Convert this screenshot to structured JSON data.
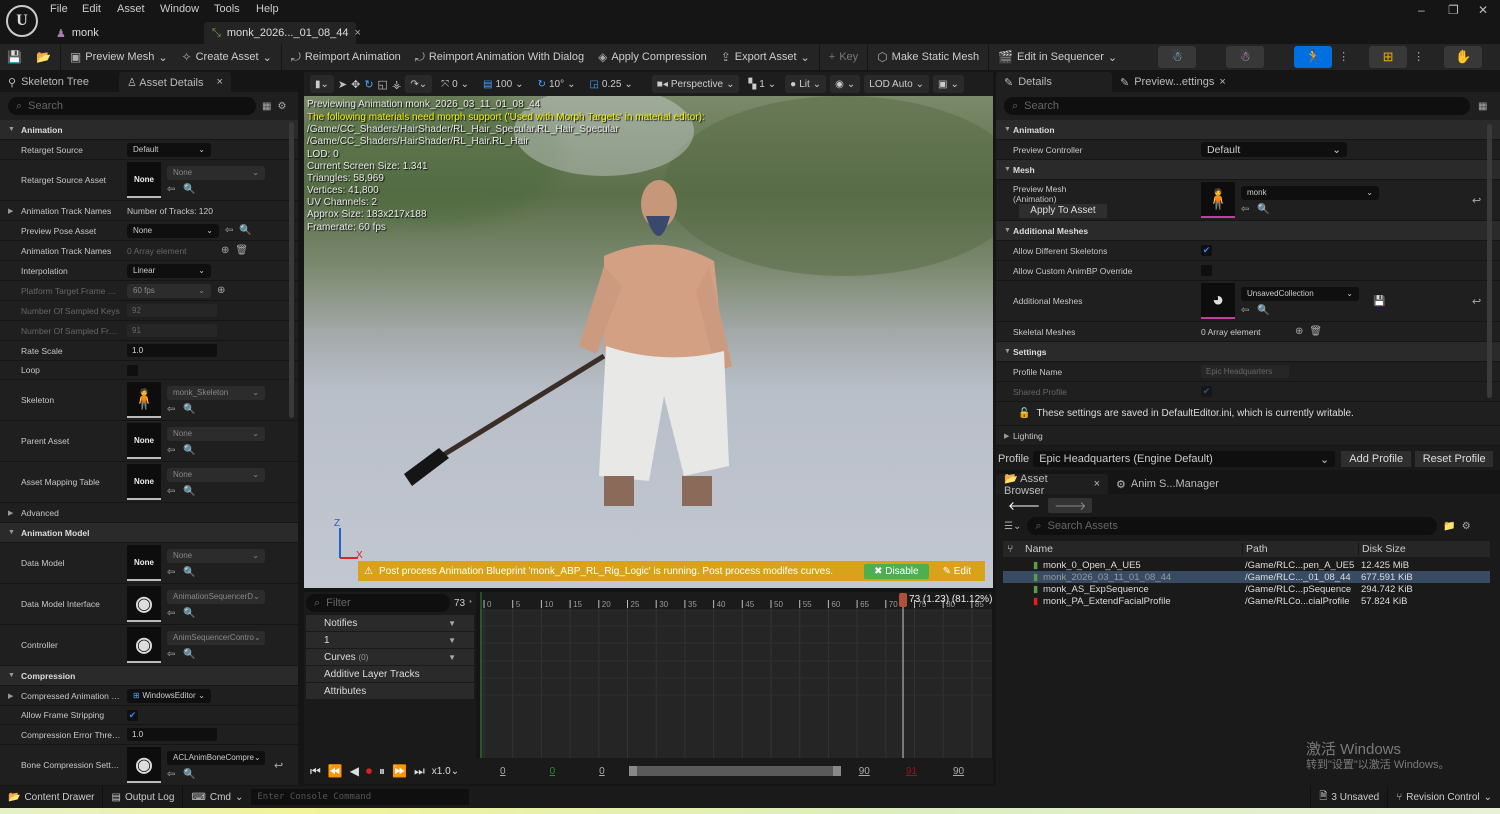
{
  "menu": [
    "File",
    "Edit",
    "Asset",
    "Window",
    "Tools",
    "Help"
  ],
  "doc_tabs": [
    {
      "label": "monk"
    },
    {
      "label": "monk_2026..._01_08_44"
    }
  ],
  "window_controls": [
    "–",
    "❐",
    "✕"
  ],
  "toolbar": {
    "save_icon": "save-icon",
    "browse_icon": "browse-icon",
    "items": [
      "Preview Mesh",
      "Create Asset",
      "Reimport Animation",
      "Reimport Animation With Dialog",
      "Apply Compression",
      "Export Asset",
      "Key",
      "Make Static Mesh",
      "Edit in Sequencer"
    ],
    "mode_colors": {
      "active": "#0070e0"
    }
  },
  "left_panel": {
    "tabs": [
      "Skeleton Tree",
      "Asset Details"
    ],
    "search_placeholder": "Search",
    "rows": [
      {
        "type": "section",
        "label": "Animation"
      },
      {
        "type": "dropdown",
        "label": "Retarget Source",
        "value": "Default"
      },
      {
        "type": "asset",
        "label": "Retarget Source Asset",
        "thumb": "None",
        "value": "None",
        "small": true
      },
      {
        "type": "text",
        "label": "Animation Track Names",
        "value": "Number of Tracks: 120",
        "expand": true
      },
      {
        "type": "dropdown",
        "label": "Preview Pose Asset",
        "value": "None",
        "icons": true
      },
      {
        "type": "array",
        "label": "Animation Track Names",
        "value": "0 Array element"
      },
      {
        "type": "dropdown",
        "label": "Interpolation",
        "value": "Linear"
      },
      {
        "type": "dropdown",
        "label": "Platform Target Frame Rate",
        "value": "60 fps",
        "disabled": true,
        "plus": true
      },
      {
        "type": "input",
        "label": "Number Of Sampled Keys",
        "value": "92",
        "disabled": true
      },
      {
        "type": "input",
        "label": "Number Of Sampled Frames",
        "value": "91",
        "disabled": true
      },
      {
        "type": "input",
        "label": "Rate Scale",
        "value": "1.0"
      },
      {
        "type": "check",
        "label": "Loop",
        "checked": false
      },
      {
        "type": "asset",
        "label": "Skeleton",
        "thumb": "",
        "value": "monk_Skeleton",
        "thumb_kind": "skeleton"
      },
      {
        "type": "asset",
        "label": "Parent Asset",
        "thumb": "None",
        "value": "None"
      },
      {
        "type": "asset",
        "label": "Asset Mapping Table",
        "thumb": "None",
        "value": "None"
      },
      {
        "type": "collapsed",
        "label": "Advanced"
      },
      {
        "type": "section",
        "label": "Animation Model"
      },
      {
        "type": "asset",
        "label": "Data Model",
        "thumb": "None",
        "value": "None"
      },
      {
        "type": "asset",
        "label": "Data Model Interface",
        "thumb": "",
        "value": "AnimationSequencerD",
        "thumb_kind": "sphere"
      },
      {
        "type": "asset",
        "label": "Controller",
        "thumb": "",
        "value": "AnimSequencerContro",
        "thumb_kind": "sphere"
      },
      {
        "type": "section",
        "label": "Compression"
      },
      {
        "type": "dropdown",
        "label": "Compressed Animation Data",
        "value": "WindowsEditor",
        "expand": true
      },
      {
        "type": "check",
        "label": "Allow Frame Stripping",
        "checked": true
      },
      {
        "type": "input",
        "label": "Compression Error Thresh...",
        "value": "1.0"
      },
      {
        "type": "asset",
        "label": "Bone Compression Settings",
        "thumb": "",
        "value": "ACLAnimBoneCompre",
        "thumb_kind": "sphere",
        "reset": true,
        "dark": true
      }
    ]
  },
  "viewport": {
    "toolbar": {
      "translate_snap": "0",
      "grid": "100",
      "rotate_snap": "10°",
      "scale_snap": "0.25",
      "view": "Perspective",
      "speed": "1",
      "lighting": "Lit",
      "lod": "LOD Auto"
    },
    "overlay": {
      "previewing": "Previewing Animation monk_2026_03_11_01_08_44",
      "warning": "The following materials need morph support ('Used with Morph Targets' in material editor):",
      "paths": [
        "/Game/CC_Shaders/HairShader/RL_Hair_Specular.RL_Hair_Specular",
        "/Game/CC_Shaders/HairShader/RL_Hair.RL_Hair"
      ],
      "stats": [
        "LOD: 0",
        "Current Screen Size: 1.341",
        "Triangles: 58,969",
        "Vertices: 41,800",
        "UV Channels: 2",
        "Approx Size: 183x217x188",
        "Framerate: 60 fps"
      ]
    },
    "axis": {
      "z": "Z",
      "x": "X"
    },
    "banner": {
      "text": "Post process Animation Blueprint 'monk_ABP_RL_Rig_Logic' is running. Post process modifes curves.",
      "disable": "Disable",
      "edit": "Edit"
    }
  },
  "timeline": {
    "filter_placeholder": "Filter",
    "current_frame": "73",
    "tracks": [
      {
        "label": "Notifies",
        "dd": true
      },
      {
        "label": "1",
        "dd": true
      },
      {
        "label": "Curves",
        "count": "(0)",
        "dd": true
      },
      {
        "label": "Additive Layer Tracks"
      },
      {
        "label": "Attributes"
      }
    ],
    "ticks": [
      0,
      5,
      10,
      15,
      20,
      25,
      30,
      35,
      40,
      45,
      50,
      55,
      60,
      65,
      70,
      75,
      80,
      85,
      90
    ],
    "max_frame": 91,
    "playhead_label": "73 (1.23) (81.12%)",
    "playhead_frame": 73,
    "speed": "x1.0",
    "range": {
      "start": "0",
      "start_green": "0",
      "view_start": "0",
      "view_end": "90",
      "end_red": "91",
      "end": "90"
    }
  },
  "right_panel": {
    "tabs": [
      "Details",
      "Preview...ettings"
    ],
    "search_placeholder": "Search",
    "rows": [
      {
        "type": "section",
        "label": "Animation"
      },
      {
        "type": "dropdown",
        "label": "Preview Controller",
        "value": "Default",
        "big": true
      },
      {
        "type": "section",
        "label": "Mesh"
      },
      {
        "type": "asset",
        "label": "Preview Mesh\n(Animation)",
        "thumb": "",
        "value": "monk",
        "thumb_kind": "person",
        "button": "Apply To Asset",
        "reset": true
      },
      {
        "type": "section",
        "label": "Additional Meshes"
      },
      {
        "type": "check",
        "label": "Allow Different Skeletons",
        "checked": true
      },
      {
        "type": "check",
        "label": "Allow Custom AnimBP Override",
        "checked": false
      },
      {
        "type": "asset",
        "label": "Additional Meshes",
        "thumb": "",
        "value": "UnsavedCollection",
        "thumb_kind": "pie",
        "reset": true,
        "save": true
      },
      {
        "type": "array",
        "label": "Skeletal Meshes",
        "value": "0 Array element"
      },
      {
        "type": "section",
        "label": "Settings"
      },
      {
        "type": "input",
        "label": "Profile Name",
        "value": "Epic Headquarters",
        "disabled": true
      },
      {
        "type": "check",
        "label": "Shared Profile",
        "checked": true,
        "dimlabel": true
      },
      {
        "type": "note",
        "label": "These settings are saved in DefaultEditor.ini, which is currently writable."
      },
      {
        "type": "collapsed",
        "label": "Lighting"
      }
    ],
    "profile": {
      "label": "Profile",
      "value": "Epic Headquarters (Engine Default)",
      "add": "Add Profile",
      "reset": "Reset Profile"
    }
  },
  "asset_browser": {
    "tabs": [
      "Asset Browser",
      "Anim S...Manager"
    ],
    "search_placeholder": "Search Assets",
    "columns": [
      "Name",
      "Path",
      "Disk Size"
    ],
    "rows": [
      {
        "name": "monk_0_Open_A_UE5",
        "path": "/Game/RLC...pen_A_UE5",
        "size": "12.425 MiB",
        "color": "#5a9a4a"
      },
      {
        "name": "monk_2026_03_11_01_08_44",
        "path": "/Game/RLC..._01_08_44",
        "size": "677.591 KiB",
        "color": "#5a9a4a",
        "selected": true
      },
      {
        "name": "monk_AS_ExpSequence",
        "path": "/Game/RLC...pSequence",
        "size": "294.742 KiB",
        "color": "#5a9a4a"
      },
      {
        "name": "monk_PA_ExtendFacialProfile",
        "path": "/Game/RLCo...cialProfile",
        "size": "57.824 KiB",
        "color": "#e02020"
      }
    ],
    "watermark": [
      "激活 Windows",
      "转到\"设置\"以激活 Windows。"
    ]
  },
  "statusbar": {
    "content_drawer": "Content Drawer",
    "output_log": "Output Log",
    "cmd": "Cmd",
    "console_placeholder": "Enter Console Command",
    "unsaved": "3 Unsaved",
    "revision": "Revision Control"
  }
}
